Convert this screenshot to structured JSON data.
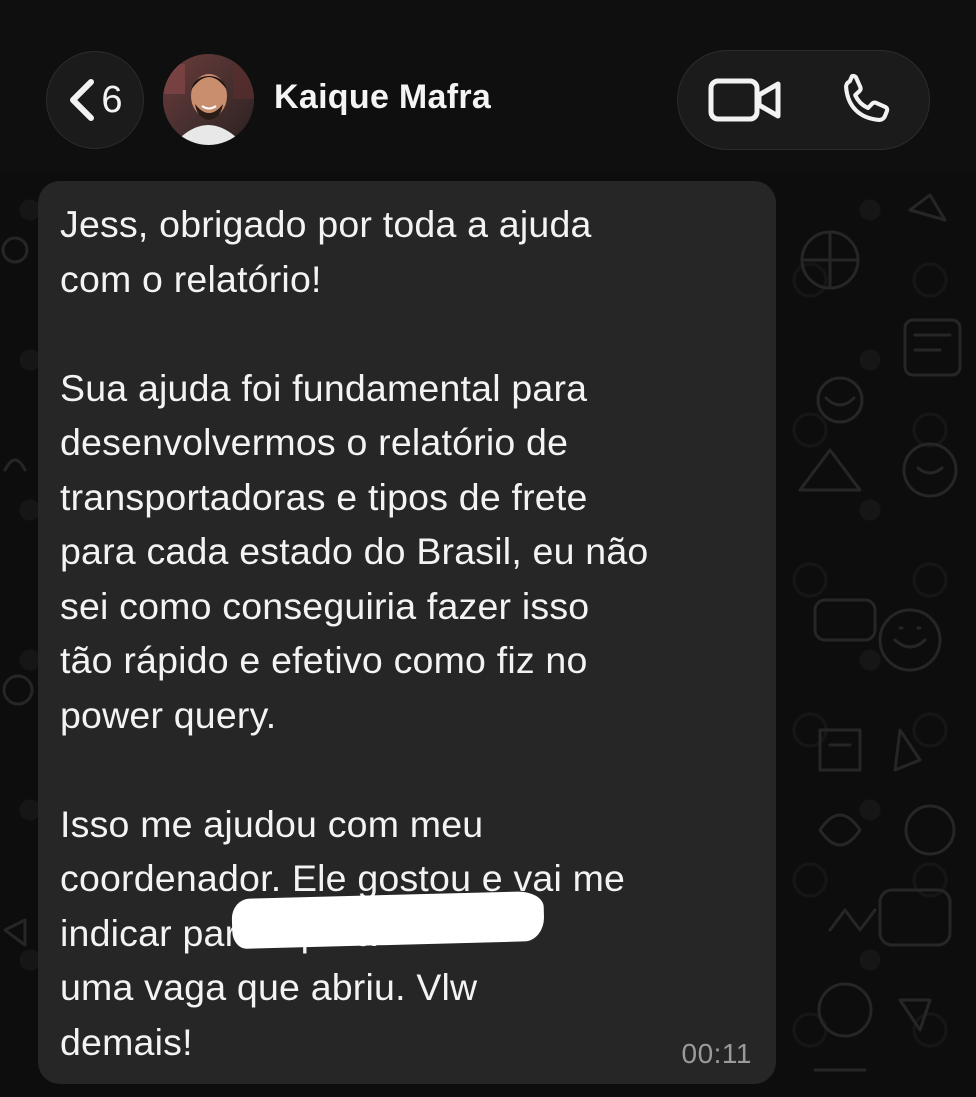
{
  "header": {
    "back_count": "6",
    "contact_name": "Kaique Mafra"
  },
  "message": {
    "paragraphs": [
      "Jess, obrigado por toda a ajuda\ncom o relatório!",
      "Sua ajuda foi fundamental para\ndesenvolvermos o relatório de\ntransportadoras e tipos de frete\npara cada estado do Brasil, eu não\nsei como conseguiria fazer isso\ntão rápido e efetivo como fiz no\npower query.",
      "Isso me ajudou com meu\ncoordenador. Ele gostou e vai me\nindicar para                         o para\numa vaga que abriu. Vlw\ndemais!"
    ],
    "time": "00:11"
  },
  "icons": {
    "back": "chevron-left-icon",
    "video": "video-camera-icon",
    "phone": "phone-icon"
  },
  "colors": {
    "background": "#0c0c0c",
    "bubble": "#262626",
    "text": "#f3f3f3",
    "timestamp": "#9a9a9a"
  }
}
